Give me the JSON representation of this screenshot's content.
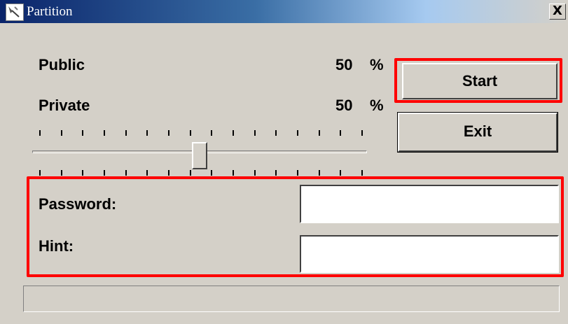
{
  "window": {
    "title": "Partition",
    "close_label": "X"
  },
  "partition": {
    "public_label": "Public",
    "public_value": "50",
    "public_unit": "%",
    "private_label": "Private",
    "private_value": "50",
    "private_unit": "%",
    "slider_fraction": 0.5,
    "tick_count": 16
  },
  "buttons": {
    "start_label": "Start",
    "exit_label": "Exit"
  },
  "fields": {
    "password_label": "Password:",
    "password_value": "",
    "hint_label": "Hint:",
    "hint_value": ""
  },
  "status": {
    "text": ""
  },
  "colors": {
    "highlight": "#ff0000",
    "titlebar_start": "#0a246a",
    "face": "#d4d0c8"
  }
}
